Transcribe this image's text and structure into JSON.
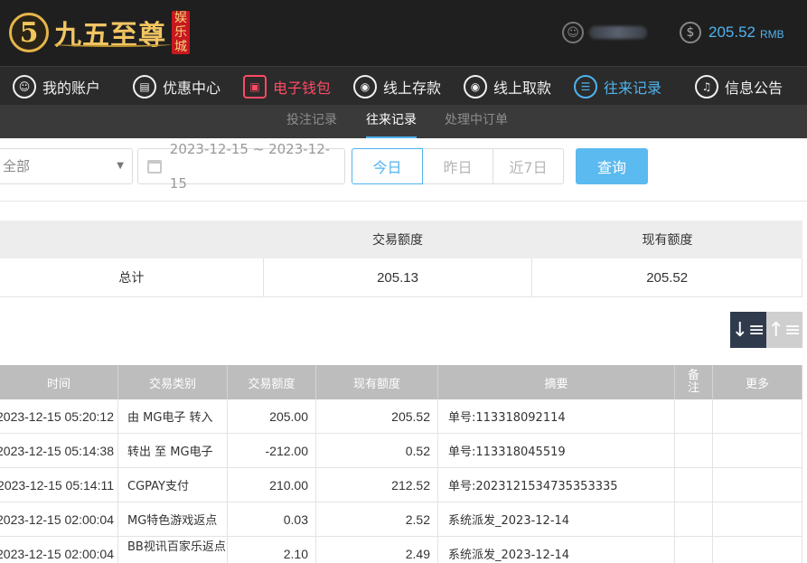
{
  "header": {
    "logo_badge": "5",
    "logo_text": "九五至尊",
    "logo_tag": [
      "娱",
      "乐",
      "城"
    ],
    "balance_value": "205.52",
    "balance_unit": "RMB"
  },
  "nav": {
    "items": [
      {
        "label": "我的账户",
        "icon": "user-icon"
      },
      {
        "label": "优惠中心",
        "icon": "gift-icon"
      },
      {
        "label": "电子钱包",
        "icon": "wallet-icon"
      },
      {
        "label": "线上存款",
        "icon": "deposit-icon"
      },
      {
        "label": "线上取款",
        "icon": "withdraw-icon"
      },
      {
        "label": "往来记录",
        "icon": "record-icon"
      },
      {
        "label": "信息公告",
        "icon": "bell-icon"
      }
    ],
    "colors": {
      "active_wallet": "#ff4a64",
      "active_record": "#4fb3ee"
    }
  },
  "subnav": {
    "items": [
      "投注记录",
      "往来记录",
      "处理中订单"
    ],
    "active": "往来记录"
  },
  "filter": {
    "select_value": "全部",
    "date_range": "2023-12-15 ~ 2023-12-15",
    "quick": [
      "今日",
      "昨日",
      "近7日"
    ],
    "query_label": "查询"
  },
  "summary": {
    "headers": [
      "",
      "交易额度",
      "现有额度"
    ],
    "row": {
      "label": "总计",
      "amount": "205.13",
      "balance": "205.52"
    }
  },
  "table": {
    "headers": {
      "time": "时间",
      "type": "交易类别",
      "amount": "交易额度",
      "balance": "现有额度",
      "summary": "摘要",
      "note": "备注",
      "more": "更多"
    },
    "rows": [
      {
        "time": "2023-12-15 05:20:12",
        "type": "由 MG电子 转入",
        "amount": "205.00",
        "balance": "205.52",
        "summary": "单号:113318092114"
      },
      {
        "time": "2023-12-15 05:14:38",
        "type": "转出 至 MG电子",
        "amount": "-212.00",
        "balance": "0.52",
        "summary": "单号:113318045519"
      },
      {
        "time": "2023-12-15 05:14:11",
        "type": "CGPAY支付",
        "amount": "210.00",
        "balance": "212.52",
        "summary": "单号:2023121534735353335"
      },
      {
        "time": "2023-12-15 02:00:04",
        "type": "MG特色游戏返点",
        "amount": "0.03",
        "balance": "2.52",
        "summary": "系统派发_2023-12-14"
      },
      {
        "time": "2023-12-15 02:00:04",
        "type": "BB视讯百家乐返点",
        "amount": "2.10",
        "balance": "2.49",
        "summary": "系统派发_2023-12-14"
      }
    ]
  }
}
